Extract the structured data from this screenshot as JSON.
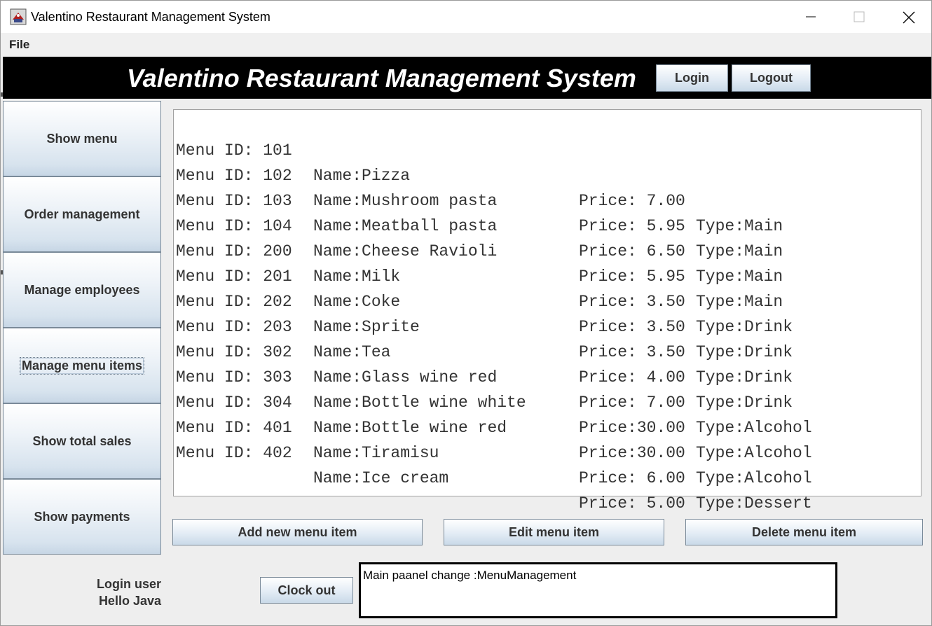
{
  "window": {
    "title": "Valentino Restaurant Management System"
  },
  "menubar": {
    "file": "File"
  },
  "banner": {
    "title": "Valentino Restaurant Management System",
    "login_label": "Login",
    "logout_label": "Logout"
  },
  "sidebar": {
    "items": [
      {
        "label": "Show menu"
      },
      {
        "label": "Order management"
      },
      {
        "label": "Manage employees"
      },
      {
        "label": "Manage menu items"
      },
      {
        "label": "Show total sales"
      },
      {
        "label": "Show payments"
      }
    ]
  },
  "menu_list": {
    "rows": [
      {
        "id": "Menu ID: 101",
        "name": "Name:Pizza",
        "price": "Price: 7.00",
        "type": "Type:Main"
      },
      {
        "id": "Menu ID: 102",
        "name": "Name:Mushroom pasta",
        "price": "Price: 5.95",
        "type": "Type:Main"
      },
      {
        "id": "Menu ID: 103",
        "name": "Name:Meatball pasta",
        "price": "Price: 6.50",
        "type": "Type:Main"
      },
      {
        "id": "Menu ID: 104",
        "name": "Name:Cheese Ravioli",
        "price": "Price: 5.95",
        "type": "Type:Main"
      },
      {
        "id": "Menu ID: 200",
        "name": "Name:Milk",
        "price": "Price: 3.50",
        "type": "Type:Drink"
      },
      {
        "id": "Menu ID: 201",
        "name": "Name:Coke",
        "price": "Price: 3.50",
        "type": "Type:Drink"
      },
      {
        "id": "Menu ID: 202",
        "name": "Name:Sprite",
        "price": "Price: 3.50",
        "type": "Type:Drink"
      },
      {
        "id": "Menu ID: 203",
        "name": "Name:Tea",
        "price": "Price: 4.00",
        "type": "Type:Drink"
      },
      {
        "id": "Menu ID: 302",
        "name": "Name:Glass wine red",
        "price": "Price: 7.00",
        "type": "Type:Alcohol"
      },
      {
        "id": "Menu ID: 303",
        "name": "Name:Bottle wine white",
        "price": "Price:30.00",
        "type": "Type:Alcohol"
      },
      {
        "id": "Menu ID: 304",
        "name": "Name:Bottle wine red",
        "price": "Price:30.00",
        "type": "Type:Alcohol"
      },
      {
        "id": "Menu ID: 401",
        "name": "Name:Tiramisu",
        "price": "Price: 6.00",
        "type": "Type:Dessert"
      },
      {
        "id": "Menu ID: 402",
        "name": "Name:Ice cream",
        "price": "Price: 5.00",
        "type": "Type:Dessert"
      }
    ]
  },
  "actions": {
    "add_label": "Add new menu item",
    "edit_label": "Edit menu item",
    "delete_label": "Delete menu item"
  },
  "footer": {
    "login_user_label": "Login user",
    "login_user_name": "Hello Java",
    "clock_out_label": "Clock out",
    "status_message": "Main paanel change :MenuManagement"
  }
}
